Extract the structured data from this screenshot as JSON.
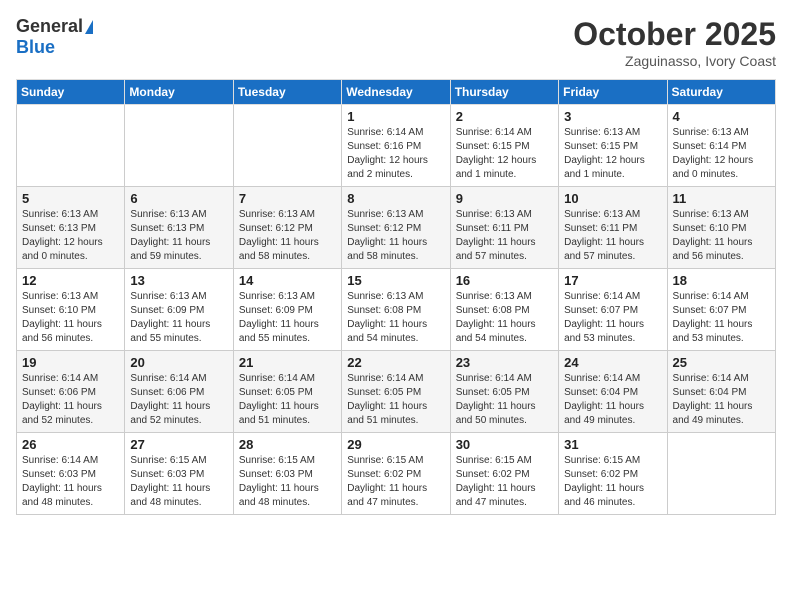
{
  "logo": {
    "general": "General",
    "blue": "Blue"
  },
  "header": {
    "title": "October 2025",
    "subtitle": "Zaguinasso, Ivory Coast"
  },
  "weekdays": [
    "Sunday",
    "Monday",
    "Tuesday",
    "Wednesday",
    "Thursday",
    "Friday",
    "Saturday"
  ],
  "weeks": [
    [
      {
        "day": "",
        "info": ""
      },
      {
        "day": "",
        "info": ""
      },
      {
        "day": "",
        "info": ""
      },
      {
        "day": "1",
        "info": "Sunrise: 6:14 AM\nSunset: 6:16 PM\nDaylight: 12 hours\nand 2 minutes."
      },
      {
        "day": "2",
        "info": "Sunrise: 6:14 AM\nSunset: 6:15 PM\nDaylight: 12 hours\nand 1 minute."
      },
      {
        "day": "3",
        "info": "Sunrise: 6:13 AM\nSunset: 6:15 PM\nDaylight: 12 hours\nand 1 minute."
      },
      {
        "day": "4",
        "info": "Sunrise: 6:13 AM\nSunset: 6:14 PM\nDaylight: 12 hours\nand 0 minutes."
      }
    ],
    [
      {
        "day": "5",
        "info": "Sunrise: 6:13 AM\nSunset: 6:13 PM\nDaylight: 12 hours\nand 0 minutes."
      },
      {
        "day": "6",
        "info": "Sunrise: 6:13 AM\nSunset: 6:13 PM\nDaylight: 11 hours\nand 59 minutes."
      },
      {
        "day": "7",
        "info": "Sunrise: 6:13 AM\nSunset: 6:12 PM\nDaylight: 11 hours\nand 58 minutes."
      },
      {
        "day": "8",
        "info": "Sunrise: 6:13 AM\nSunset: 6:12 PM\nDaylight: 11 hours\nand 58 minutes."
      },
      {
        "day": "9",
        "info": "Sunrise: 6:13 AM\nSunset: 6:11 PM\nDaylight: 11 hours\nand 57 minutes."
      },
      {
        "day": "10",
        "info": "Sunrise: 6:13 AM\nSunset: 6:11 PM\nDaylight: 11 hours\nand 57 minutes."
      },
      {
        "day": "11",
        "info": "Sunrise: 6:13 AM\nSunset: 6:10 PM\nDaylight: 11 hours\nand 56 minutes."
      }
    ],
    [
      {
        "day": "12",
        "info": "Sunrise: 6:13 AM\nSunset: 6:10 PM\nDaylight: 11 hours\nand 56 minutes."
      },
      {
        "day": "13",
        "info": "Sunrise: 6:13 AM\nSunset: 6:09 PM\nDaylight: 11 hours\nand 55 minutes."
      },
      {
        "day": "14",
        "info": "Sunrise: 6:13 AM\nSunset: 6:09 PM\nDaylight: 11 hours\nand 55 minutes."
      },
      {
        "day": "15",
        "info": "Sunrise: 6:13 AM\nSunset: 6:08 PM\nDaylight: 11 hours\nand 54 minutes."
      },
      {
        "day": "16",
        "info": "Sunrise: 6:13 AM\nSunset: 6:08 PM\nDaylight: 11 hours\nand 54 minutes."
      },
      {
        "day": "17",
        "info": "Sunrise: 6:14 AM\nSunset: 6:07 PM\nDaylight: 11 hours\nand 53 minutes."
      },
      {
        "day": "18",
        "info": "Sunrise: 6:14 AM\nSunset: 6:07 PM\nDaylight: 11 hours\nand 53 minutes."
      }
    ],
    [
      {
        "day": "19",
        "info": "Sunrise: 6:14 AM\nSunset: 6:06 PM\nDaylight: 11 hours\nand 52 minutes."
      },
      {
        "day": "20",
        "info": "Sunrise: 6:14 AM\nSunset: 6:06 PM\nDaylight: 11 hours\nand 52 minutes."
      },
      {
        "day": "21",
        "info": "Sunrise: 6:14 AM\nSunset: 6:05 PM\nDaylight: 11 hours\nand 51 minutes."
      },
      {
        "day": "22",
        "info": "Sunrise: 6:14 AM\nSunset: 6:05 PM\nDaylight: 11 hours\nand 51 minutes."
      },
      {
        "day": "23",
        "info": "Sunrise: 6:14 AM\nSunset: 6:05 PM\nDaylight: 11 hours\nand 50 minutes."
      },
      {
        "day": "24",
        "info": "Sunrise: 6:14 AM\nSunset: 6:04 PM\nDaylight: 11 hours\nand 49 minutes."
      },
      {
        "day": "25",
        "info": "Sunrise: 6:14 AM\nSunset: 6:04 PM\nDaylight: 11 hours\nand 49 minutes."
      }
    ],
    [
      {
        "day": "26",
        "info": "Sunrise: 6:14 AM\nSunset: 6:03 PM\nDaylight: 11 hours\nand 48 minutes."
      },
      {
        "day": "27",
        "info": "Sunrise: 6:15 AM\nSunset: 6:03 PM\nDaylight: 11 hours\nand 48 minutes."
      },
      {
        "day": "28",
        "info": "Sunrise: 6:15 AM\nSunset: 6:03 PM\nDaylight: 11 hours\nand 48 minutes."
      },
      {
        "day": "29",
        "info": "Sunrise: 6:15 AM\nSunset: 6:02 PM\nDaylight: 11 hours\nand 47 minutes."
      },
      {
        "day": "30",
        "info": "Sunrise: 6:15 AM\nSunset: 6:02 PM\nDaylight: 11 hours\nand 47 minutes."
      },
      {
        "day": "31",
        "info": "Sunrise: 6:15 AM\nSunset: 6:02 PM\nDaylight: 11 hours\nand 46 minutes."
      },
      {
        "day": "",
        "info": ""
      }
    ]
  ]
}
